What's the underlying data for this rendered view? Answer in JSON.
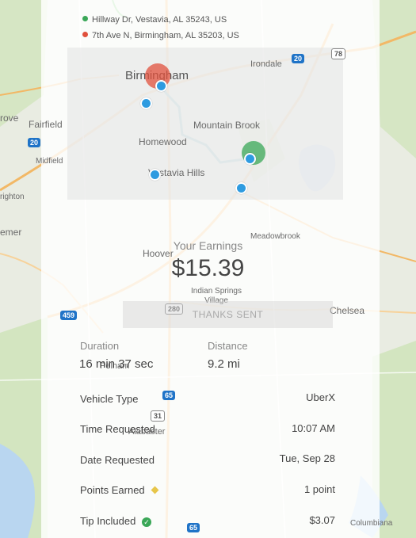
{
  "trip": {
    "pickup_address": "Hillway Dr, Vestavia, AL 35243, US",
    "dropoff_address": "7th Ave N, Birmingham, AL 35203, US",
    "pickup_color": "#3aa757",
    "dropoff_color": "#e0503c"
  },
  "map": {
    "route_color": "#45a7b8",
    "water_color": "#a9cdee",
    "park_color": "#cfe3b8",
    "cities": {
      "birmingham": "Birmingham",
      "irondale": "Irondale",
      "mountain_brook": "Mountain Brook",
      "homewood": "Homewood",
      "vestavia": "Vestavia Hills",
      "fairfield": "Fairfield",
      "midfield": "Midfield",
      "grove": "rove",
      "brighton": "righton",
      "bessemer": "emer",
      "meadowbrook": "Meadowbrook",
      "hoover": "Hoover",
      "indian_springs": "Indian Springs Village",
      "chelsea": "Chelsea",
      "pelham": "Pelham",
      "alabaster": "Alabaster",
      "columbiana": "Columbiana"
    },
    "shields": {
      "i20": "20",
      "i459": "459",
      "i65": "65",
      "us31": "31",
      "us280": "280",
      "i78": "78",
      "i20b": "20",
      "i65b": "65"
    }
  },
  "earnings": {
    "title": "Your Earnings",
    "amount": "$15.39"
  },
  "thanks_button": "THANKS SENT",
  "stats": {
    "duration_label": "Duration",
    "duration_value": "16 min 37 sec",
    "distance_label": "Distance",
    "distance_value": "9.2 mi"
  },
  "details": [
    {
      "label": "Vehicle Type",
      "value": "UberX"
    },
    {
      "label": "Time Requested",
      "value": "10:07 AM"
    },
    {
      "label": "Date Requested",
      "value": "Tue, Sep 28"
    },
    {
      "label": "Points Earned",
      "value": "1 point",
      "icon": "diamond-icon",
      "icon_color": "#e7c64a"
    },
    {
      "label": "Tip Included",
      "value": "$3.07",
      "icon": "check-circle-icon",
      "icon_color": "#3aa757"
    }
  ]
}
